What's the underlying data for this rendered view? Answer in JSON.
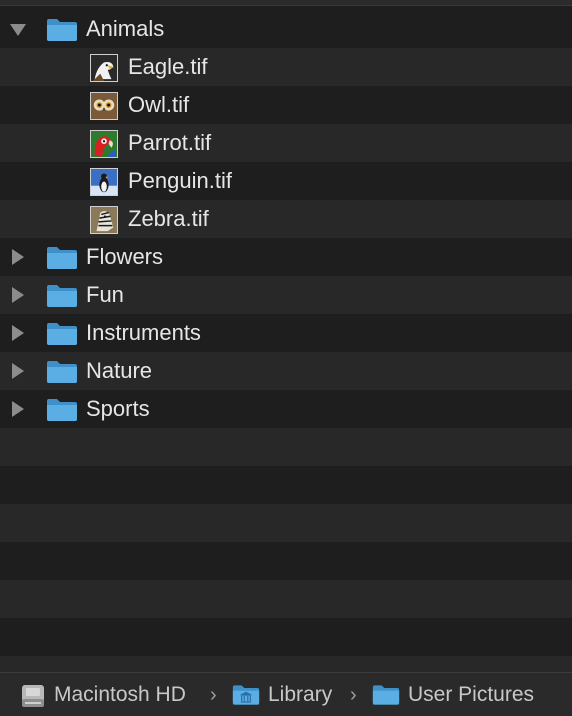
{
  "tree": {
    "expanded_folder": {
      "label": "Animals",
      "icon": "folder-icon"
    },
    "files": [
      {
        "label": "Eagle.tif",
        "icon": "eagle-thumbnail-icon"
      },
      {
        "label": "Owl.tif",
        "icon": "owl-thumbnail-icon"
      },
      {
        "label": "Parrot.tif",
        "icon": "parrot-thumbnail-icon"
      },
      {
        "label": "Penguin.tif",
        "icon": "penguin-thumbnail-icon"
      },
      {
        "label": "Zebra.tif",
        "icon": "zebra-thumbnail-icon"
      }
    ],
    "collapsed_folders": [
      {
        "label": "Flowers"
      },
      {
        "label": "Fun"
      },
      {
        "label": "Instruments"
      },
      {
        "label": "Nature"
      },
      {
        "label": "Sports"
      }
    ]
  },
  "path_bar": {
    "items": [
      {
        "label": "Macintosh HD",
        "icon": "hard-drive-icon"
      },
      {
        "label": "Library",
        "icon": "library-folder-icon"
      },
      {
        "label": "User Pictures",
        "icon": "folder-icon"
      }
    ],
    "separator": "›"
  },
  "colors": {
    "background": "#1e1e1e",
    "alt_row": "#282828",
    "folder_blue": "#5aaee3",
    "text": "#e6e6e6"
  }
}
